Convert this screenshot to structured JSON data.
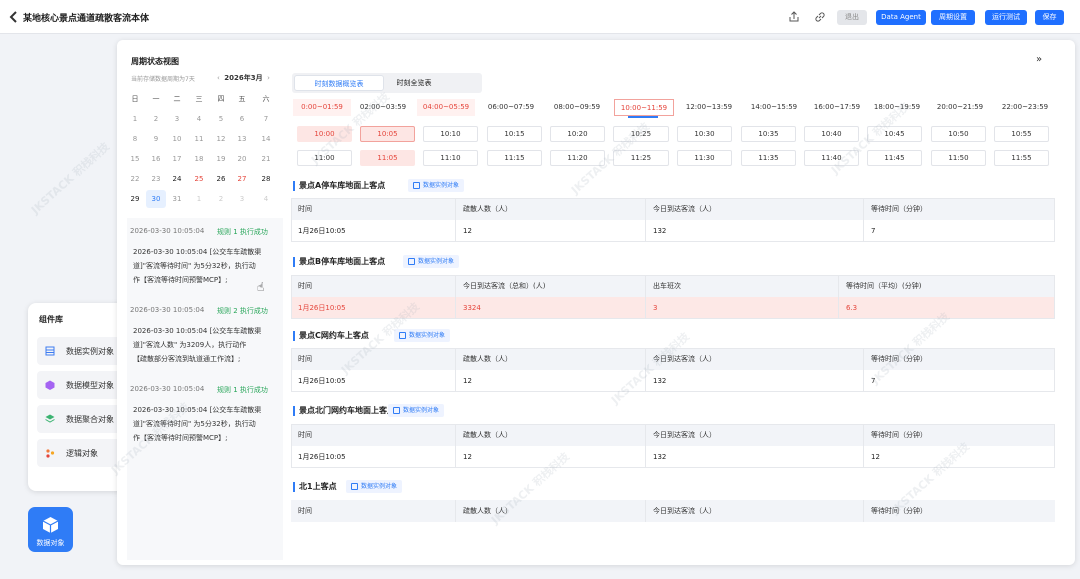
{
  "header": {
    "title": "某地核心景点通道疏散客流本体",
    "exit": "退出",
    "data_agent": "Data Agent",
    "period_settings": "周期设置",
    "run_test": "运行测试",
    "save": "保存"
  },
  "library": {
    "title": "组件库",
    "items": [
      {
        "label": "数据实例对象"
      },
      {
        "label": "数据模型对象"
      },
      {
        "label": "数据聚合对象"
      },
      {
        "label": "逻辑对象"
      }
    ],
    "data_object_button": "数据对象"
  },
  "calendar": {
    "title": "周期状态视图",
    "hint": "当前存储数据周期为7天",
    "month": "2026年3月",
    "weekdays": [
      "日",
      "一",
      "二",
      "三",
      "四",
      "五",
      "六"
    ],
    "weeks": [
      [
        "1",
        "2",
        "3",
        "4",
        "5",
        "6",
        "7"
      ],
      [
        "8",
        "9",
        "10",
        "11",
        "12",
        "13",
        "14"
      ],
      [
        "15",
        "16",
        "17",
        "18",
        "19",
        "20",
        "21"
      ],
      [
        "22",
        "23",
        "24",
        "25",
        "26",
        "27",
        "28"
      ],
      [
        "29",
        "30",
        "31",
        "1",
        "2",
        "3",
        "4"
      ]
    ]
  },
  "logs": [
    {
      "time": "2026-03-30 10:05:04",
      "status": "规则 1 执行成功",
      "lines": [
        "2026-03-30 10:05:04 [公交车车疏散渠",
        "道]\"客流等待时间\" 为5分32秒，执行动",
        "作【客流等待时间预警MCP】;"
      ]
    },
    {
      "time": "2026-03-30 10:05:04",
      "status": "规则 2 执行成功",
      "lines": [
        "2026-03-30 10:05:04 [公交车车疏散渠",
        "道]\"客流人数\" 为3209人，执行动作",
        "【疏散部分客流到轨道通工作流】;"
      ]
    },
    {
      "time": "2026-03-30 10:05:04",
      "status": "规则 1 执行成功",
      "lines": [
        "2026-03-30 10:05:04 [公交车车疏散渠",
        "道]\"客流等待时间\" 为5分32秒，执行动",
        "作【客流等待时间预警MCP】;"
      ]
    }
  ],
  "tabs": [
    "时刻数据概览表",
    "时刻全览表"
  ],
  "ranges": [
    "0:00~01:59",
    "02:00~03:59",
    "04:00~05:59",
    "06:00~07:59",
    "08:00~09:59",
    "10:00~11:59",
    "12:00~13:59",
    "14:00~15:59",
    "16:00~17:59",
    "18:00~19:59",
    "20:00~21:59",
    "22:00~23:59"
  ],
  "slots_row1": [
    "10:00",
    "10:05",
    "10:10",
    "10:15",
    "10:20",
    "10:25",
    "10:30",
    "10:35",
    "10:40",
    "10:45",
    "10:50",
    "10:55"
  ],
  "slots_row2": [
    "11:00",
    "11:05",
    "11:10",
    "11:15",
    "11:20",
    "11:25",
    "11:30",
    "11:35",
    "11:40",
    "11:45",
    "11:50",
    "11:55"
  ],
  "tag_label": "数据实例对象",
  "sections": [
    {
      "title": "景点A停车库地面上客点",
      "headers": [
        "时间",
        "疏散人数（人）",
        "今日到达客流（人）",
        "等待时间（分钟）"
      ],
      "rows": [
        [
          "1月26日10:05",
          "12",
          "132",
          "7"
        ]
      ]
    },
    {
      "title": "景点B停车库地面上客点",
      "headers": [
        "时间",
        "今日到达客流（总和）(人)",
        "出车班次",
        "等待时间（平均）(分钟)"
      ],
      "rows": [
        [
          "1月26日10:05",
          "3324",
          "3",
          "6.3"
        ]
      ]
    },
    {
      "title": "景点C网约车上客点",
      "headers": [
        "时间",
        "疏散人数（人）",
        "今日到达客流（人）",
        "等待时间（分钟）"
      ],
      "rows": [
        [
          "1月26日10:05",
          "12",
          "132",
          "7"
        ]
      ]
    },
    {
      "title": "景点北门网约车地面上客点",
      "headers": [
        "时间",
        "疏散人数（人）",
        "今日到达客流（人）",
        "等待时间（分钟）"
      ],
      "rows": [
        [
          "1月26日10:05",
          "12",
          "132",
          "12"
        ]
      ]
    },
    {
      "title": "北1上客点",
      "headers": [
        "时间",
        "疏散人数（人）",
        "今日到达客流（人）",
        "等待时间（分钟）"
      ],
      "rows": []
    }
  ],
  "watermark": "JKSTACK 积栈科技",
  "colors": {
    "accent": "#2f7cf6",
    "danger": "#e5453b",
    "success": "#29a65a"
  }
}
